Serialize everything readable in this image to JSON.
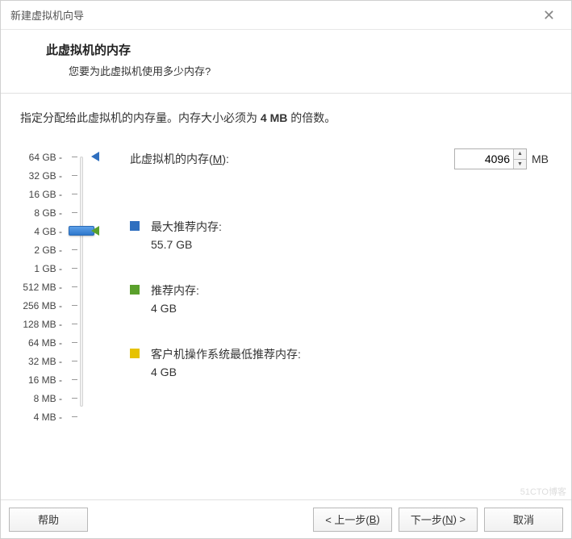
{
  "window": {
    "title": "新建虚拟机向导"
  },
  "header": {
    "heading": "此虚拟机的内存",
    "subtitle": "您要为此虚拟机使用多少内存?"
  },
  "instruction": {
    "prefix": "指定分配给此虚拟机的内存量。内存大小必须为 ",
    "bold": "4 MB",
    "suffix": " 的倍数。"
  },
  "slider": {
    "ticks": [
      "64 GB",
      "32 GB",
      "16 GB",
      "8 GB",
      "4 GB",
      "2 GB",
      "1 GB",
      "512 MB",
      "256 MB",
      "128 MB",
      "64 MB",
      "32 MB",
      "16 MB",
      "8 MB",
      "4 MB"
    ],
    "current_index": 4,
    "markers": {
      "max_index": 0,
      "rec_index": 4,
      "min_index": 4
    }
  },
  "memory": {
    "label_prefix": "此虚拟机的内存(",
    "label_key": "M",
    "label_suffix": "):",
    "value": "4096",
    "unit": "MB"
  },
  "recommend": {
    "max": {
      "label": "最大推荐内存:",
      "value": "55.7 GB"
    },
    "rec": {
      "label": "推荐内存:",
      "value": "4 GB"
    },
    "min": {
      "label": "客户机操作系统最低推荐内存:",
      "value": "4 GB"
    }
  },
  "buttons": {
    "help": "帮助",
    "back_prefix": "< 上一步(",
    "back_key": "B",
    "back_suffix": ")",
    "next_prefix": "下一步(",
    "next_key": "N",
    "next_suffix": ") >",
    "cancel": "取消"
  },
  "watermark": "51CTO博客"
}
